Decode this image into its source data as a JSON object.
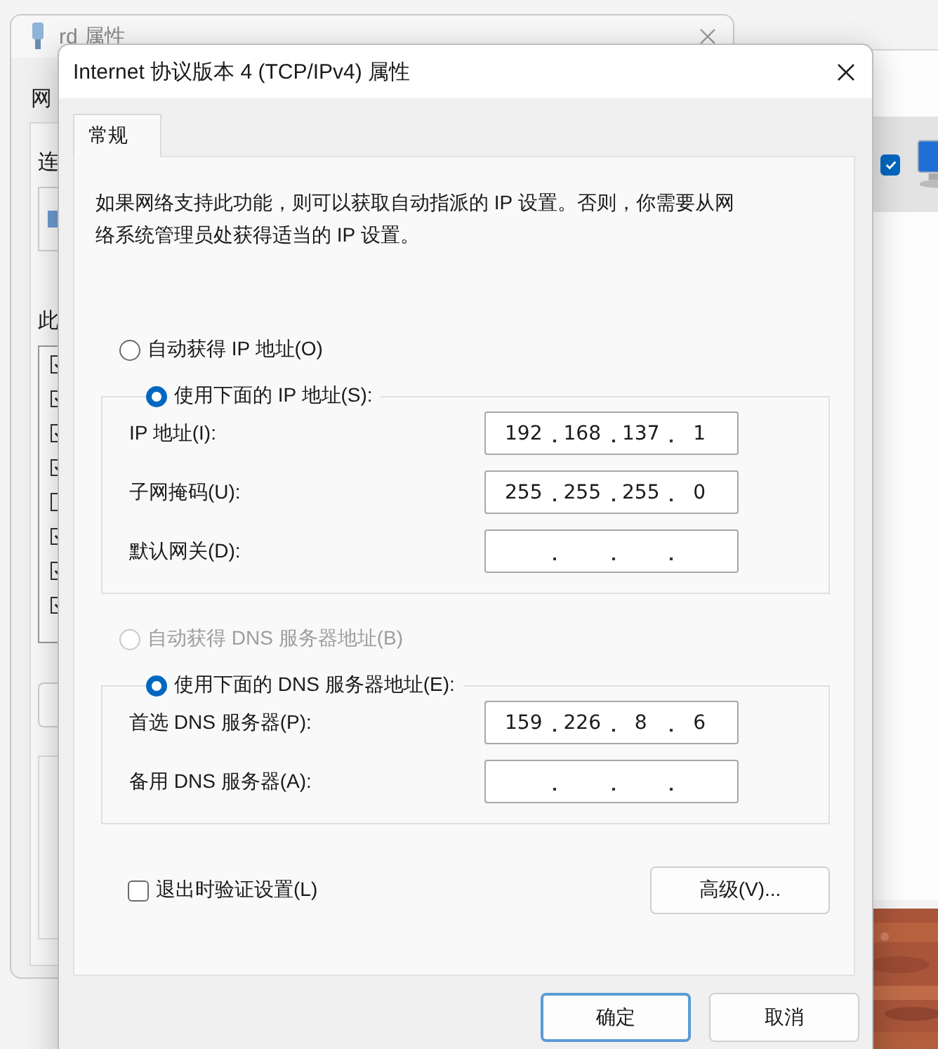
{
  "background_window": {
    "title": "rd 属性",
    "tab": "网",
    "labels": [
      "连",
      "此"
    ],
    "components": [
      {
        "checked": true
      },
      {
        "checked": true
      },
      {
        "checked": true
      },
      {
        "checked": true
      },
      {
        "checked": false
      },
      {
        "checked": true
      },
      {
        "checked": true
      },
      {
        "checked": true
      }
    ]
  },
  "dialog": {
    "title": "Internet 协议版本 4 (TCP/IPv4) 属性",
    "tabs": [
      {
        "label": "常规",
        "selected": true
      }
    ],
    "description": "如果网络支持此功能，则可以获取自动指派的 IP 设置。否则，你需要从网络系统管理员处获得适当的 IP 设置。",
    "ip_mode": [
      {
        "label": "自动获得 IP 地址(O)",
        "selected": false,
        "disabled": false
      },
      {
        "label": "使用下面的 IP 地址(S):",
        "selected": true,
        "disabled": false
      }
    ],
    "ip_fields": [
      {
        "label": "IP 地址(I):",
        "octets": [
          "192",
          "168",
          "137",
          "1"
        ]
      },
      {
        "label": "子网掩码(U):",
        "octets": [
          "255",
          "255",
          "255",
          "0"
        ]
      },
      {
        "label": "默认网关(D):"
      }
    ],
    "dns_mode": [
      {
        "label": "自动获得 DNS 服务器地址(B)",
        "selected": false,
        "disabled": true
      },
      {
        "label": "使用下面的 DNS 服务器地址(E):",
        "selected": true,
        "disabled": false
      }
    ],
    "dns_fields": [
      {
        "label": "首选 DNS 服务器(P):",
        "octets": [
          "159",
          "226",
          "8",
          "6"
        ]
      },
      {
        "label": "备用 DNS 服务器(A):"
      }
    ],
    "validate_on_exit": {
      "label": "退出时验证设置(L)",
      "checked": false
    },
    "advanced_button": "高级(V)...",
    "buttons": [
      {
        "label": "确定",
        "default": true
      },
      {
        "label": "取消",
        "default": false
      }
    ]
  },
  "right_window": {
    "item_checked": true
  }
}
